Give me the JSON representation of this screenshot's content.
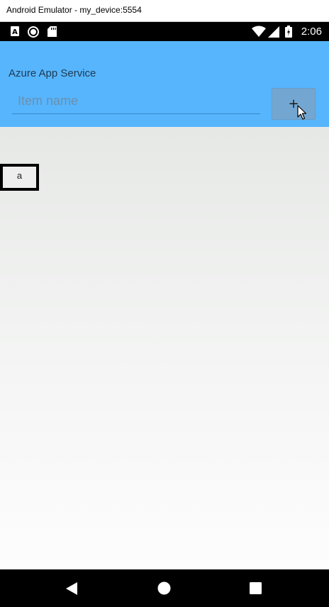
{
  "window": {
    "title": "Android Emulator - my_device:5554"
  },
  "status_bar": {
    "time": "2:06",
    "left_icons": [
      "a-notification-icon",
      "record-icon",
      "sd-card-icon"
    ],
    "right_icons": [
      "wifi-icon",
      "cell-signal-icon",
      "battery-icon"
    ]
  },
  "app": {
    "title": "Azure App Service",
    "input_placeholder": "Item name",
    "input_value": "",
    "add_label": "+"
  },
  "items": [
    {
      "label": "a"
    }
  ],
  "nav": [
    "back-icon",
    "home-icon",
    "recents-icon"
  ],
  "colors": {
    "appbar": "#56b5fd",
    "button": "#73a7d1",
    "statusbar": "#000000",
    "navbar": "#000000"
  }
}
